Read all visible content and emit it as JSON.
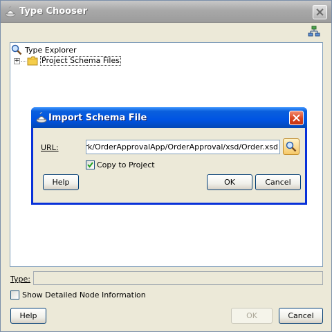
{
  "window": {
    "title": "Type Chooser",
    "type_label": "Type:",
    "type_value": "",
    "show_detailed_label": "Show Detailed Node Information",
    "show_detailed_checked": false,
    "help_label": "Help",
    "ok_label": "OK",
    "cancel_label": "Cancel"
  },
  "tree": {
    "root_label": "Type Explorer",
    "children": [
      {
        "label": "Project Schema Files",
        "expander": "+"
      }
    ]
  },
  "dialog": {
    "title": "Import Schema File",
    "url_label": "URL:",
    "url_value": "ywork/OrderApprovalApp/OrderApproval/xsd/Order.xsd",
    "copy_label": "Copy to Project",
    "copy_checked": true,
    "help_label": "Help",
    "ok_label": "OK",
    "cancel_label": "Cancel"
  },
  "colors": {
    "active_title": "#0054e3",
    "inactive_title": "#a8a8a8",
    "dialog_face": "#ece9d8"
  },
  "icons": [
    "app-icon",
    "close-icon",
    "hierarchy-icon",
    "search-icon",
    "folder-icon",
    "checkmark-icon",
    "expand-plus-icon"
  ]
}
